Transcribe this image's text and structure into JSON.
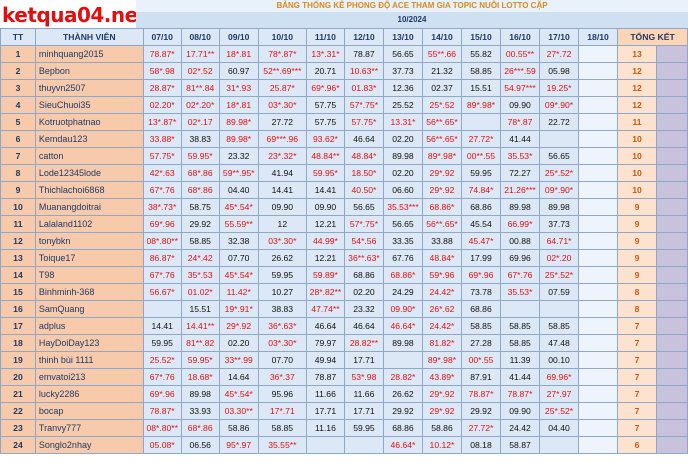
{
  "logo": "ketqua04.net",
  "title": "BẢNG THỐNG KÊ PHONG ĐỘ ACE THAM GIA TOPIC NUÔI LOTTO CẶP",
  "month": "10/2024",
  "headers": {
    "tt": "TT",
    "member": "THÀNH VIÊN",
    "dates": [
      "07/10",
      "08/10",
      "09/10",
      "10/10",
      "11/10",
      "12/10",
      "13/10",
      "14/10",
      "15/10",
      "16/10",
      "17/10",
      "18/10"
    ],
    "total": "TỔNG KẾT"
  },
  "rows": [
    {
      "tt": "1",
      "name": "minhquang2015",
      "cells": [
        [
          "78.87*",
          "r"
        ],
        [
          "17.71**",
          "r"
        ],
        [
          "18*.81",
          "r"
        ],
        [
          "78*.87*",
          "r"
        ],
        [
          "13*.31*",
          "r"
        ],
        [
          "78.87",
          "b"
        ],
        [
          "56.65",
          "b"
        ],
        [
          "55**.66",
          "r"
        ],
        [
          "55.82",
          "b"
        ],
        [
          "00.55**",
          "r"
        ],
        [
          "27*.72",
          "r"
        ],
        [
          "",
          ""
        ]
      ],
      "total": "13"
    },
    {
      "tt": "2",
      "name": "Bepbon",
      "cells": [
        [
          "58*.98",
          "r"
        ],
        [
          "02*.52",
          "r"
        ],
        [
          "60.97",
          "b"
        ],
        [
          "52**.69***",
          "r"
        ],
        [
          "20.71",
          "b"
        ],
        [
          "10.63**",
          "r"
        ],
        [
          "37.73",
          "b"
        ],
        [
          "21.32",
          "b"
        ],
        [
          "58.85",
          "b"
        ],
        [
          "26***.59",
          "r"
        ],
        [
          "05.98",
          "b"
        ],
        [
          "",
          ""
        ]
      ],
      "total": "12"
    },
    {
      "tt": "3",
      "name": "thuyvn2507",
      "cells": [
        [
          "28.87*",
          "r"
        ],
        [
          "81**.84",
          "r"
        ],
        [
          "31*.93",
          "r"
        ],
        [
          "25.87*",
          "r"
        ],
        [
          "69*.96*",
          "r"
        ],
        [
          "01.83*",
          "r"
        ],
        [
          "12.36",
          "b"
        ],
        [
          "02.37",
          "b"
        ],
        [
          "15.51",
          "b"
        ],
        [
          "54.97***",
          "r"
        ],
        [
          "19.25*",
          "r"
        ],
        [
          "",
          ""
        ]
      ],
      "total": "12"
    },
    {
      "tt": "4",
      "name": "SieuChuoi35",
      "cells": [
        [
          "02.20*",
          "r"
        ],
        [
          "02*.20*",
          "r"
        ],
        [
          "18*.81",
          "r"
        ],
        [
          "03*.30*",
          "r"
        ],
        [
          "57.75",
          "b"
        ],
        [
          "57*.75*",
          "r"
        ],
        [
          "25.52",
          "b"
        ],
        [
          "25*.52",
          "r"
        ],
        [
          "89*.98*",
          "r"
        ],
        [
          "09.90",
          "b"
        ],
        [
          "09*.90*",
          "r"
        ],
        [
          "",
          ""
        ]
      ],
      "total": "12"
    },
    {
      "tt": "5",
      "name": "Kotruotphatnao",
      "cells": [
        [
          "13*.87*",
          "r"
        ],
        [
          "02*.17",
          "r"
        ],
        [
          "89.98*",
          "r"
        ],
        [
          "27.72",
          "b"
        ],
        [
          "57.75",
          "b"
        ],
        [
          "57.75*",
          "r"
        ],
        [
          "13.31*",
          "r"
        ],
        [
          "56**.65*",
          "r"
        ],
        [
          "",
          "b"
        ],
        [
          "78*.87",
          "r"
        ],
        [
          "22.72",
          "b"
        ],
        [
          "",
          ""
        ]
      ],
      "total": "11"
    },
    {
      "tt": "6",
      "name": "Kemdau123",
      "cells": [
        [
          "33.88*",
          "r"
        ],
        [
          "38.83",
          "b"
        ],
        [
          "89.98*",
          "r"
        ],
        [
          "69***.96",
          "r"
        ],
        [
          "93.62*",
          "r"
        ],
        [
          "46.64",
          "b"
        ],
        [
          "02.20",
          "b"
        ],
        [
          "56**.65*",
          "r"
        ],
        [
          "27.72*",
          "r"
        ],
        [
          "41.44",
          "b"
        ],
        [
          "",
          "b"
        ],
        [
          "",
          ""
        ]
      ],
      "total": "10"
    },
    {
      "tt": "7",
      "name": "catton",
      "cells": [
        [
          "57.75*",
          "r"
        ],
        [
          "59.95*",
          "r"
        ],
        [
          "23.32",
          "b"
        ],
        [
          "23*.32*",
          "r"
        ],
        [
          "48.84**",
          "r"
        ],
        [
          "48.84*",
          "r"
        ],
        [
          "89.98",
          "b"
        ],
        [
          "89*.98*",
          "r"
        ],
        [
          "00**.55",
          "r"
        ],
        [
          "35.53*",
          "r"
        ],
        [
          "56.65",
          "b"
        ],
        [
          "",
          ""
        ]
      ],
      "total": "10"
    },
    {
      "tt": "8",
      "name": "Lode12345lode",
      "cells": [
        [
          "42*.63",
          "r"
        ],
        [
          "68*.86",
          "r"
        ],
        [
          "59**.95*",
          "r"
        ],
        [
          "41.94",
          "b"
        ],
        [
          "59.95*",
          "r"
        ],
        [
          "18.50*",
          "r"
        ],
        [
          "02.20",
          "b"
        ],
        [
          "29*.92",
          "r"
        ],
        [
          "59.95",
          "b"
        ],
        [
          "72.27",
          "b"
        ],
        [
          "25*.52*",
          "r"
        ],
        [
          "",
          ""
        ]
      ],
      "total": "10"
    },
    {
      "tt": "9",
      "name": "Thichlachoi6868",
      "cells": [
        [
          "67*.76",
          "r"
        ],
        [
          "68*.86",
          "r"
        ],
        [
          "04.40",
          "b"
        ],
        [
          "14.41",
          "b"
        ],
        [
          "14.41",
          "b"
        ],
        [
          "40.50*",
          "r"
        ],
        [
          "06.60",
          "b"
        ],
        [
          "29*.92",
          "r"
        ],
        [
          "74.84*",
          "r"
        ],
        [
          "21.26***",
          "r"
        ],
        [
          "09*.90*",
          "r"
        ],
        [
          "",
          ""
        ]
      ],
      "total": "10"
    },
    {
      "tt": "10",
      "name": "Muanangdoitrai",
      "cells": [
        [
          "38*.73*",
          "r"
        ],
        [
          "58.75",
          "b"
        ],
        [
          "45*.54*",
          "r"
        ],
        [
          "09.90",
          "b"
        ],
        [
          "09.90",
          "b"
        ],
        [
          "56.65",
          "b"
        ],
        [
          "35.53***",
          "r"
        ],
        [
          "68.86*",
          "r"
        ],
        [
          "68.86",
          "b"
        ],
        [
          "89.98",
          "b"
        ],
        [
          "89.98",
          "b"
        ],
        [
          "",
          ""
        ]
      ],
      "total": "9"
    },
    {
      "tt": "11",
      "name": "Lalaland1102",
      "cells": [
        [
          "69*.96",
          "r"
        ],
        [
          "29.92",
          "b"
        ],
        [
          "55.59**",
          "r"
        ],
        [
          "12",
          "b"
        ],
        [
          "12.21",
          "b"
        ],
        [
          "57*.75*",
          "r"
        ],
        [
          "56.65",
          "b"
        ],
        [
          "56**.65*",
          "r"
        ],
        [
          "45.54",
          "b"
        ],
        [
          "66.99*",
          "r"
        ],
        [
          "37.73",
          "b"
        ],
        [
          "",
          ""
        ]
      ],
      "total": "9"
    },
    {
      "tt": "12",
      "name": "tonybkn",
      "cells": [
        [
          "08*.80**",
          "r"
        ],
        [
          "58.85",
          "b"
        ],
        [
          "32.38",
          "b"
        ],
        [
          "03*.30*",
          "r"
        ],
        [
          "44.99*",
          "r"
        ],
        [
          "54*.56",
          "r"
        ],
        [
          "33.35",
          "b"
        ],
        [
          "33.88",
          "b"
        ],
        [
          "45.47*",
          "r"
        ],
        [
          "00.88",
          "b"
        ],
        [
          "64.71*",
          "r"
        ],
        [
          "",
          ""
        ]
      ],
      "total": "9"
    },
    {
      "tt": "13",
      "name": "Toique17",
      "cells": [
        [
          "86.87*",
          "r"
        ],
        [
          "24*.42",
          "r"
        ],
        [
          "07.70",
          "b"
        ],
        [
          "26.62",
          "b"
        ],
        [
          "12.21",
          "b"
        ],
        [
          "36**.63*",
          "r"
        ],
        [
          "67.76",
          "b"
        ],
        [
          "48.84*",
          "r"
        ],
        [
          "17.99",
          "b"
        ],
        [
          "69.96",
          "b"
        ],
        [
          "02*.20",
          "r"
        ],
        [
          "",
          ""
        ]
      ],
      "total": "9"
    },
    {
      "tt": "14",
      "name": "T98",
      "cells": [
        [
          "67*.76",
          "r"
        ],
        [
          "35*.53",
          "r"
        ],
        [
          "45*.54*",
          "r"
        ],
        [
          "59.95",
          "b"
        ],
        [
          "59.89*",
          "r"
        ],
        [
          "68.86",
          "b"
        ],
        [
          "68.86*",
          "r"
        ],
        [
          "59*.96",
          "r"
        ],
        [
          "69*.96",
          "r"
        ],
        [
          "67*.76",
          "r"
        ],
        [
          "25*.52*",
          "r"
        ],
        [
          "",
          ""
        ]
      ],
      "total": "9"
    },
    {
      "tt": "15",
      "name": "Binhminh-368",
      "cells": [
        [
          "56.67*",
          "r"
        ],
        [
          "01.02*",
          "r"
        ],
        [
          "11.42*",
          "r"
        ],
        [
          "10.27",
          "b"
        ],
        [
          "28*.82**",
          "r"
        ],
        [
          "02.20",
          "b"
        ],
        [
          "24.29",
          "b"
        ],
        [
          "24.42*",
          "r"
        ],
        [
          "73.78",
          "b"
        ],
        [
          "35.53*",
          "r"
        ],
        [
          "07.59",
          "b"
        ],
        [
          "",
          ""
        ]
      ],
      "total": "8"
    },
    {
      "tt": "16",
      "name": "SamQuang",
      "cells": [
        [
          "",
          "b"
        ],
        [
          "15.51",
          "b"
        ],
        [
          "19*.91*",
          "r"
        ],
        [
          "38.83",
          "b"
        ],
        [
          "47.74**",
          "r"
        ],
        [
          "23.32",
          "b"
        ],
        [
          "09.90*",
          "r"
        ],
        [
          "26*.62",
          "r"
        ],
        [
          "68.86",
          "b"
        ],
        [
          "",
          "b"
        ],
        [
          "",
          "b"
        ],
        [
          "",
          ""
        ]
      ],
      "total": "8"
    },
    {
      "tt": "17",
      "name": "adplus",
      "cells": [
        [
          "14.41",
          "b"
        ],
        [
          "14.41**",
          "r"
        ],
        [
          "29*.92",
          "r"
        ],
        [
          "36*.63*",
          "r"
        ],
        [
          "46.64",
          "b"
        ],
        [
          "46.64",
          "b"
        ],
        [
          "46.64*",
          "r"
        ],
        [
          "24.42*",
          "r"
        ],
        [
          "58.85",
          "b"
        ],
        [
          "58.85",
          "b"
        ],
        [
          "58.85",
          "b"
        ],
        [
          "",
          ""
        ]
      ],
      "total": "7"
    },
    {
      "tt": "18",
      "name": "HayDoiDay123",
      "cells": [
        [
          "59.95",
          "b"
        ],
        [
          "81**.82",
          "r"
        ],
        [
          "02.20",
          "b"
        ],
        [
          "03*.30*",
          "r"
        ],
        [
          "79.97",
          "b"
        ],
        [
          "28.82**",
          "r"
        ],
        [
          "89.98",
          "b"
        ],
        [
          "81.82*",
          "r"
        ],
        [
          "27.28",
          "b"
        ],
        [
          "58.85",
          "b"
        ],
        [
          "47.48",
          "b"
        ],
        [
          "",
          ""
        ]
      ],
      "total": "7"
    },
    {
      "tt": "19",
      "name": "thinh bùi 1111",
      "cells": [
        [
          "25.52*",
          "r"
        ],
        [
          "59.95*",
          "r"
        ],
        [
          "33**.99",
          "r"
        ],
        [
          "07.70",
          "b"
        ],
        [
          "49.94",
          "b"
        ],
        [
          "17.71",
          "b"
        ],
        [
          "",
          "b"
        ],
        [
          "89*.98*",
          "r"
        ],
        [
          "00*.55",
          "r"
        ],
        [
          "11.39",
          "b"
        ],
        [
          "00.10",
          "b"
        ],
        [
          "",
          ""
        ]
      ],
      "total": "7"
    },
    {
      "tt": "20",
      "name": "emvatoi213",
      "cells": [
        [
          "67*.76",
          "r"
        ],
        [
          "18.68*",
          "r"
        ],
        [
          "14.64",
          "b"
        ],
        [
          "36*.37",
          "r"
        ],
        [
          "78.87",
          "b"
        ],
        [
          "53*.98",
          "r"
        ],
        [
          "28.82*",
          "r"
        ],
        [
          "43.89*",
          "r"
        ],
        [
          "87.91",
          "b"
        ],
        [
          "41.44",
          "b"
        ],
        [
          "69.96*",
          "r"
        ],
        [
          "",
          ""
        ]
      ],
      "total": "7"
    },
    {
      "tt": "21",
      "name": "lucky2286",
      "cells": [
        [
          "69*.96",
          "r"
        ],
        [
          "89.98",
          "b"
        ],
        [
          "45*.54*",
          "r"
        ],
        [
          "95.96",
          "b"
        ],
        [
          "11.66",
          "b"
        ],
        [
          "11.66",
          "b"
        ],
        [
          "26.62",
          "b"
        ],
        [
          "29*.92",
          "r"
        ],
        [
          "78.87*",
          "r"
        ],
        [
          "78.87*",
          "r"
        ],
        [
          "27*.97",
          "r"
        ],
        [
          "",
          ""
        ]
      ],
      "total": "7"
    },
    {
      "tt": "22",
      "name": "bocap",
      "cells": [
        [
          "78.87*",
          "r"
        ],
        [
          "33.93",
          "b"
        ],
        [
          "03.30**",
          "r"
        ],
        [
          "17*.71",
          "r"
        ],
        [
          "17.71",
          "b"
        ],
        [
          "17.71",
          "b"
        ],
        [
          "29.92",
          "b"
        ],
        [
          "29*.92",
          "r"
        ],
        [
          "29.92",
          "b"
        ],
        [
          "09.90",
          "b"
        ],
        [
          "25*.52*",
          "r"
        ],
        [
          "",
          ""
        ]
      ],
      "total": "7"
    },
    {
      "tt": "23",
      "name": "Tranvy777",
      "cells": [
        [
          "08*.80**",
          "r"
        ],
        [
          "68*.86",
          "r"
        ],
        [
          "58.86",
          "b"
        ],
        [
          "58.85",
          "b"
        ],
        [
          "11.16",
          "b"
        ],
        [
          "59.95",
          "b"
        ],
        [
          "68.86",
          "b"
        ],
        [
          "58.86",
          "b"
        ],
        [
          "27.72*",
          "r"
        ],
        [
          "24.42",
          "b"
        ],
        [
          "04.40",
          "b"
        ],
        [
          "",
          ""
        ]
      ],
      "total": "7"
    },
    {
      "tt": "24",
      "name": "Songlo2nhay",
      "cells": [
        [
          "05.08*",
          "r"
        ],
        [
          "06.56",
          "b"
        ],
        [
          "95*.97",
          "r"
        ],
        [
          "35.55**",
          "r"
        ],
        [
          "",
          "b"
        ],
        [
          "",
          "b"
        ],
        [
          "46.64*",
          "r"
        ],
        [
          "10.12*",
          "r"
        ],
        [
          "08.18",
          "b"
        ],
        [
          "58.87",
          "b"
        ],
        [
          "",
          "b"
        ],
        [
          "",
          ""
        ]
      ],
      "total": "6"
    }
  ]
}
